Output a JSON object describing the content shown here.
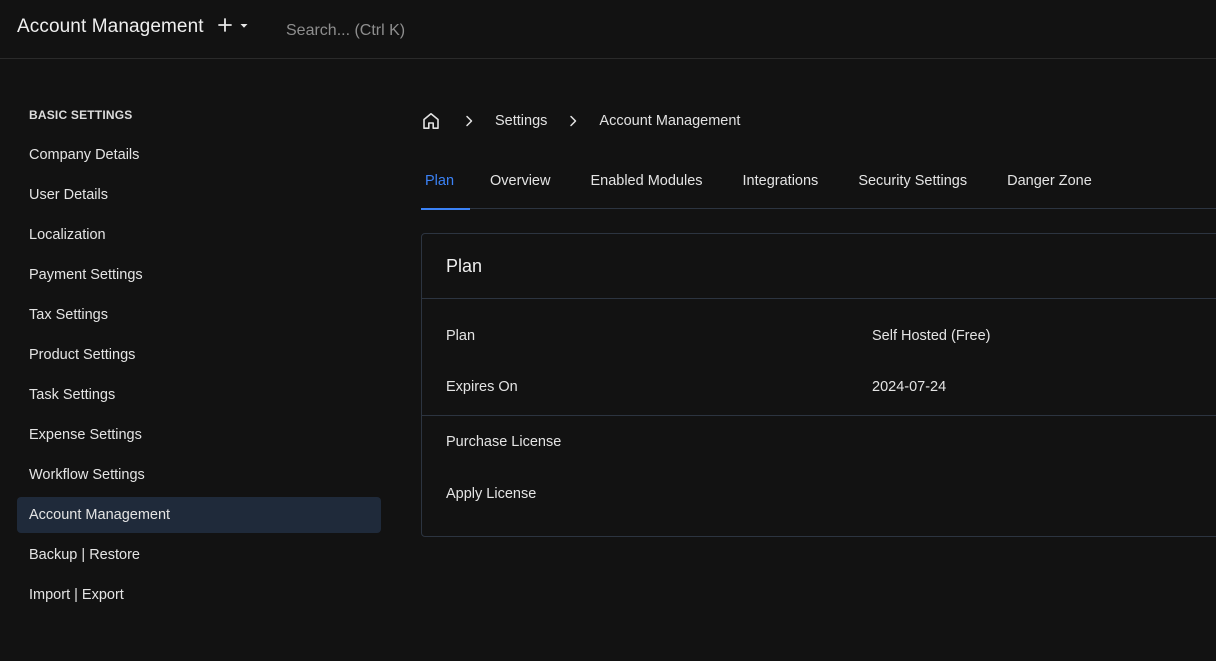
{
  "header": {
    "title": "Account Management",
    "search_placeholder": "Search... (Ctrl K)"
  },
  "sidebar": {
    "heading": "BASIC SETTINGS",
    "items": [
      {
        "label": "Company Details"
      },
      {
        "label": "User Details"
      },
      {
        "label": "Localization"
      },
      {
        "label": "Payment Settings"
      },
      {
        "label": "Tax Settings"
      },
      {
        "label": "Product Settings"
      },
      {
        "label": "Task Settings"
      },
      {
        "label": "Expense Settings"
      },
      {
        "label": "Workflow Settings"
      },
      {
        "label": "Account Management",
        "active": true
      },
      {
        "label": "Backup | Restore"
      },
      {
        "label": "Import | Export"
      }
    ]
  },
  "breadcrumb": {
    "items": [
      "Settings",
      "Account Management"
    ]
  },
  "tabs": [
    {
      "label": "Plan",
      "active": true
    },
    {
      "label": "Overview"
    },
    {
      "label": "Enabled Modules"
    },
    {
      "label": "Integrations"
    },
    {
      "label": "Security Settings"
    },
    {
      "label": "Danger Zone"
    }
  ],
  "card": {
    "title": "Plan",
    "fields": [
      {
        "label": "Plan",
        "value": "Self Hosted (Free)"
      },
      {
        "label": "Expires On",
        "value": "2024-07-24"
      }
    ],
    "links": [
      "Purchase License",
      "Apply License"
    ]
  },
  "colors": {
    "background": "#121212",
    "accent": "#3b82f6",
    "active_sidebar_bg": "#1f2a3a",
    "border": "#2c3440"
  },
  "icons": [
    "plus-icon",
    "caret-down-icon",
    "home-icon",
    "chevron-right-icon"
  ]
}
